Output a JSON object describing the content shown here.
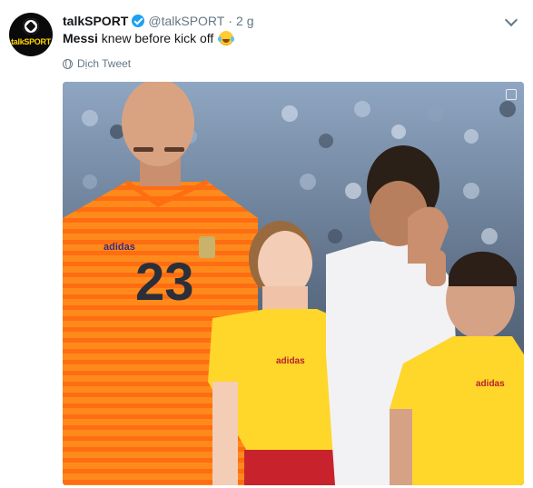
{
  "account": {
    "name": "talkSPORT",
    "handle": "@talkSPORT",
    "separator": "·",
    "time": "2 g",
    "avatar_text": "talkSPORT",
    "verified": true
  },
  "tweet": {
    "text_bold": "Messi",
    "text_rest": " knew before kick off",
    "emoji": "face-with-tears-of-joy"
  },
  "actions": {
    "translate_label": "Dịch Tweet",
    "menu_icon": "chevron-down-icon"
  },
  "media": {
    "jersey_number": "23",
    "kit_brand": "adidas"
  },
  "colors": {
    "verified": "#1da1f2",
    "muted_text": "#657786",
    "orange_kit": "#ff8a1c",
    "yellow_kit": "#ffd62a"
  }
}
